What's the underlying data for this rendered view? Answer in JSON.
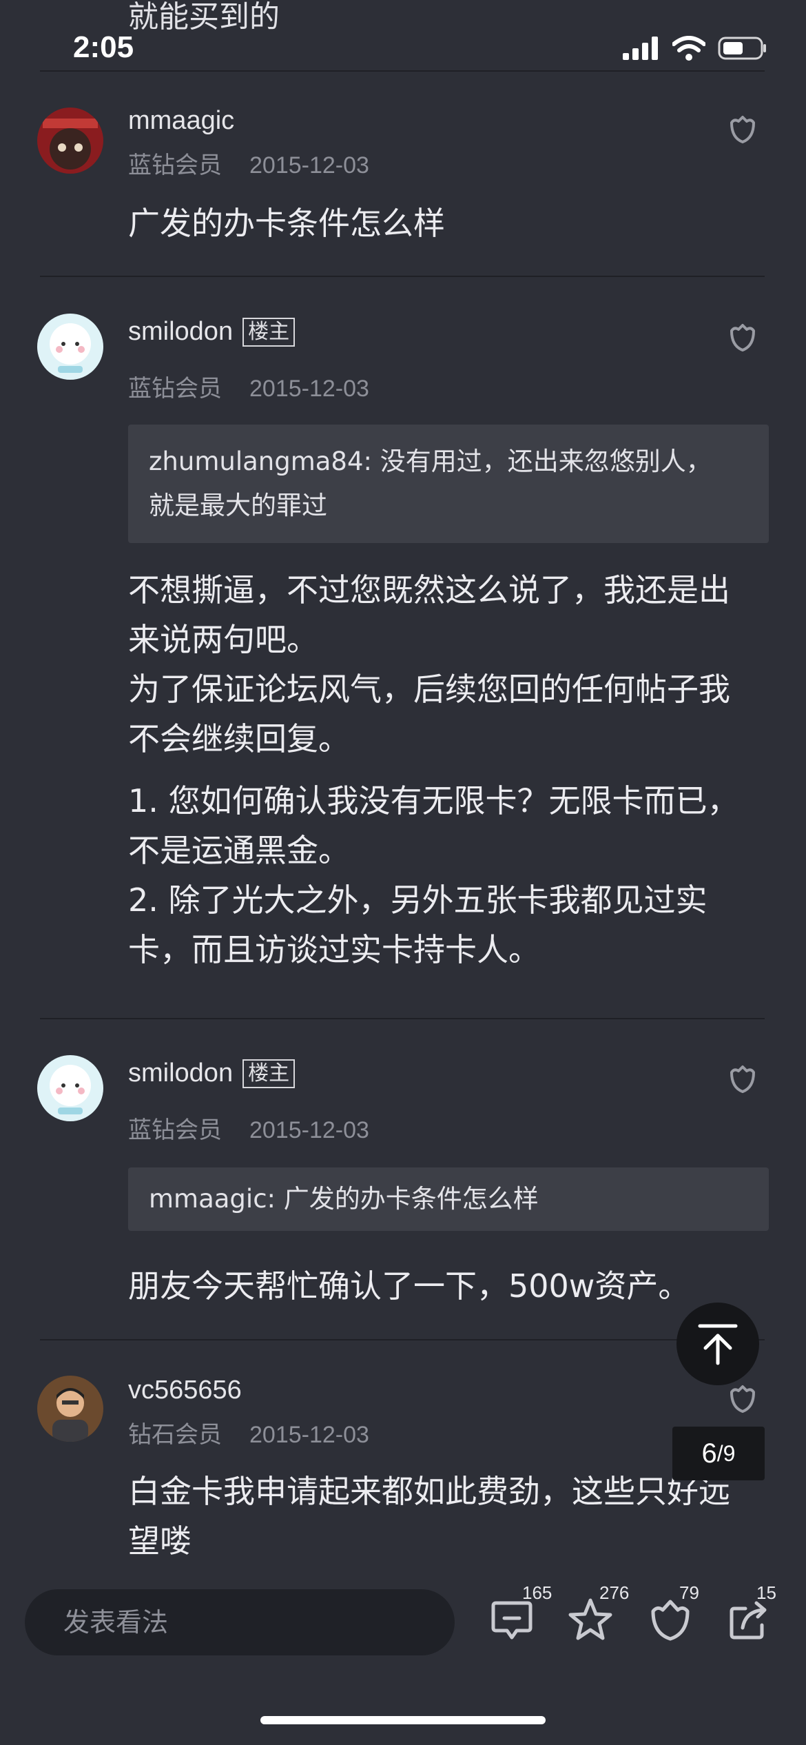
{
  "status_bar": {
    "time": "2:05",
    "partial_text": "就能买到的"
  },
  "posts": [
    {
      "username": "mmaagic",
      "rank": "蓝钻会员",
      "date": "2015-12-03",
      "body": [
        "广发的办卡条件怎么样"
      ]
    },
    {
      "username": "smilodon",
      "badge": "楼主",
      "rank": "蓝钻会员",
      "date": "2015-12-03",
      "quote": [
        "zhumulangma84: 没有用过，还出来忽悠别人，",
        "就是最大的罪过"
      ],
      "body": [
        "不想撕逼，不过您既然这么说了，我还是出",
        "来说两句吧。",
        "为了保证论坛风气，后续您回的任何帖子我",
        "不会继续回复。",
        "1. 您如何确认我没有无限卡？无限卡而已，",
        "不是运通黑金。",
        "2. 除了光大之外，另外五张卡我都见过实",
        "卡，而且访谈过实卡持卡人。"
      ]
    },
    {
      "username": "smilodon",
      "badge": "楼主",
      "rank": "蓝钻会员",
      "date": "2015-12-03",
      "quote": [
        "mmaagic: 广发的办卡条件怎么样"
      ],
      "body": [
        "朋友今天帮忙确认了一下，500w资产。"
      ]
    },
    {
      "username": "vc565656",
      "rank": "钻石会员",
      "date": "2015-12-03",
      "body": [
        "白金卡我申请起来都如此费劲，这些只好远",
        "望喽"
      ]
    }
  ],
  "page_indicator": {
    "current": "6",
    "total": "/9"
  },
  "bottom_bar": {
    "input_placeholder": "发表看法",
    "comments_count": "165",
    "favorites_count": "276",
    "likes_count": "79",
    "shares_count": "15"
  },
  "colors": {
    "background": "#2d2f37",
    "quote_bg": "#3d3f47",
    "muted_text": "#8d8f98"
  }
}
